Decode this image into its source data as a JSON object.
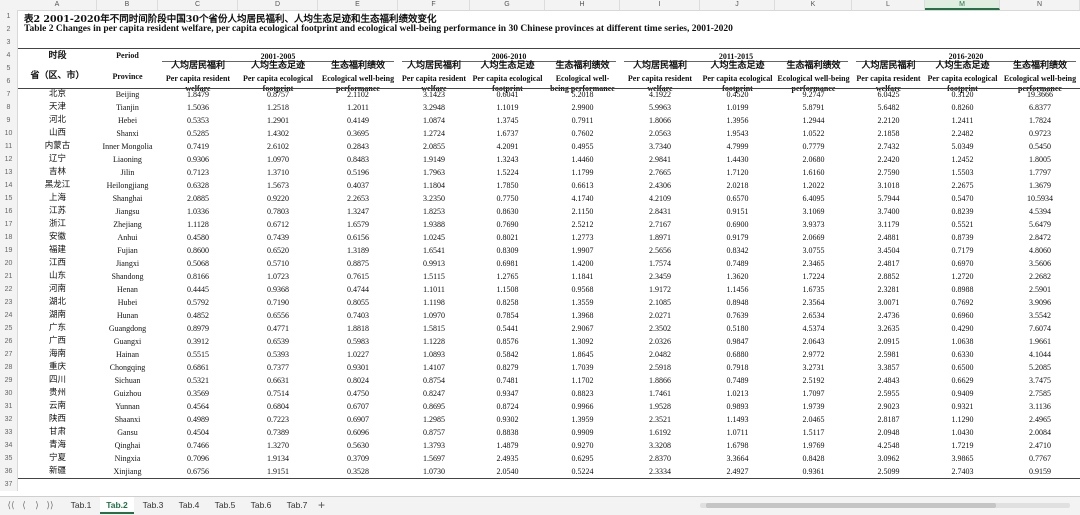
{
  "columns": [
    "A",
    "B",
    "C",
    "D",
    "E",
    "F",
    "G",
    "H",
    "I",
    "J",
    "K",
    "L",
    "M",
    "N"
  ],
  "selected_column": "M",
  "row_numbers": [
    1,
    2,
    3,
    4,
    5,
    6,
    7,
    8,
    9,
    10,
    11,
    12,
    13,
    14,
    15,
    16,
    17,
    18,
    19,
    20,
    21,
    22,
    23,
    24,
    25,
    26,
    27,
    28,
    29,
    30,
    31,
    32,
    33,
    34,
    35,
    36,
    37
  ],
  "title_cn": "表2 2001-2020年不同时间阶段中国30个省份人均居民福利、人均生态足迹和生态福利绩效变化",
  "title_en": "Table 2 Changes in per capita resident welfare, per capita ecological footprint and ecological well-being performance in 30 Chinese provinces at different time series, 2001-2020",
  "header": {
    "period_cn": "时段",
    "period_en": "Period",
    "province_cn": "省（区、市）",
    "province_en": "Province",
    "periods": [
      "2001-2005",
      "2006-2010",
      "2011-2015",
      "2016-2020"
    ],
    "metrics_cn": [
      "人均居民福利",
      "人均生态足迹",
      "生态福利绩效"
    ],
    "metrics_en": [
      "Per capita resident welfare",
      "Per capita ecological footprint",
      "Ecological well-being performance"
    ]
  },
  "rows": [
    {
      "cn": "北京",
      "en": "Beijing",
      "v": [
        "1.8479",
        "0.8757",
        "2.1102",
        "3.1423",
        "0.6041",
        "5.2018",
        "4.1922",
        "0.4520",
        "9.2747",
        "6.0425",
        "0.3120",
        "19.3666"
      ]
    },
    {
      "cn": "天津",
      "en": "Tianjin",
      "v": [
        "1.5036",
        "1.2518",
        "1.2011",
        "3.2948",
        "1.1019",
        "2.9900",
        "5.9963",
        "1.0199",
        "5.8791",
        "5.6482",
        "0.8260",
        "6.8377"
      ]
    },
    {
      "cn": "河北",
      "en": "Hebei",
      "v": [
        "0.5353",
        "1.2901",
        "0.4149",
        "1.0874",
        "1.3745",
        "0.7911",
        "1.8066",
        "1.3956",
        "1.2944",
        "2.2120",
        "1.2411",
        "1.7824"
      ]
    },
    {
      "cn": "山西",
      "en": "Shanxi",
      "v": [
        "0.5285",
        "1.4302",
        "0.3695",
        "1.2724",
        "1.6737",
        "0.7602",
        "2.0563",
        "1.9543",
        "1.0522",
        "2.1858",
        "2.2482",
        "0.9723"
      ]
    },
    {
      "cn": "内蒙古",
      "en": "Inner Mongolia",
      "v": [
        "0.7419",
        "2.6102",
        "0.2843",
        "2.0855",
        "4.2091",
        "0.4955",
        "3.7340",
        "4.7999",
        "0.7779",
        "2.7432",
        "5.0349",
        "0.5450"
      ]
    },
    {
      "cn": "辽宁",
      "en": "Liaoning",
      "v": [
        "0.9306",
        "1.0970",
        "0.8483",
        "1.9149",
        "1.3243",
        "1.4460",
        "2.9841",
        "1.4430",
        "2.0680",
        "2.2420",
        "1.2452",
        "1.8005"
      ]
    },
    {
      "cn": "吉林",
      "en": "Jilin",
      "v": [
        "0.7123",
        "1.3710",
        "0.5196",
        "1.7963",
        "1.5224",
        "1.1799",
        "2.7665",
        "1.7120",
        "1.6160",
        "2.7590",
        "1.5503",
        "1.7797"
      ]
    },
    {
      "cn": "黑龙江",
      "en": "Heilongjiang",
      "v": [
        "0.6328",
        "1.5673",
        "0.4037",
        "1.1804",
        "1.7850",
        "0.6613",
        "2.4306",
        "2.0218",
        "1.2022",
        "3.1018",
        "2.2675",
        "1.3679"
      ]
    },
    {
      "cn": "上海",
      "en": "Shanghai",
      "v": [
        "2.0885",
        "0.9220",
        "2.2653",
        "3.2350",
        "0.7750",
        "4.1740",
        "4.2109",
        "0.6570",
        "6.4095",
        "5.7944",
        "0.5470",
        "10.5934"
      ]
    },
    {
      "cn": "江苏",
      "en": "Jiangsu",
      "v": [
        "1.0336",
        "0.7803",
        "1.3247",
        "1.8253",
        "0.8630",
        "2.1150",
        "2.8431",
        "0.9151",
        "3.1069",
        "3.7400",
        "0.8239",
        "4.5394"
      ]
    },
    {
      "cn": "浙江",
      "en": "Zhejiang",
      "v": [
        "1.1128",
        "0.6712",
        "1.6579",
        "1.9388",
        "0.7690",
        "2.5212",
        "2.7167",
        "0.6900",
        "3.9373",
        "3.1179",
        "0.5521",
        "5.6479"
      ]
    },
    {
      "cn": "安徽",
      "en": "Anhui",
      "v": [
        "0.4580",
        "0.7439",
        "0.6156",
        "1.0245",
        "0.8021",
        "1.2773",
        "1.8971",
        "0.9179",
        "2.0669",
        "2.4881",
        "0.8739",
        "2.8472"
      ]
    },
    {
      "cn": "福建",
      "en": "Fujian",
      "v": [
        "0.8600",
        "0.6520",
        "1.3189",
        "1.6541",
        "0.8309",
        "1.9907",
        "2.5656",
        "0.8342",
        "3.0755",
        "3.4504",
        "0.7179",
        "4.8060"
      ]
    },
    {
      "cn": "江西",
      "en": "Jiangxi",
      "v": [
        "0.5068",
        "0.5710",
        "0.8875",
        "0.9913",
        "0.6981",
        "1.4200",
        "1.7574",
        "0.7489",
        "2.3465",
        "2.4817",
        "0.6970",
        "3.5606"
      ]
    },
    {
      "cn": "山东",
      "en": "Shandong",
      "v": [
        "0.8166",
        "1.0723",
        "0.7615",
        "1.5115",
        "1.2765",
        "1.1841",
        "2.3459",
        "1.3620",
        "1.7224",
        "2.8852",
        "1.2720",
        "2.2682"
      ]
    },
    {
      "cn": "河南",
      "en": "Henan",
      "v": [
        "0.4445",
        "0.9368",
        "0.4744",
        "1.1011",
        "1.1508",
        "0.9568",
        "1.9172",
        "1.1456",
        "1.6735",
        "2.3281",
        "0.8988",
        "2.5901"
      ]
    },
    {
      "cn": "湖北",
      "en": "Hubei",
      "v": [
        "0.5792",
        "0.7190",
        "0.8055",
        "1.1198",
        "0.8258",
        "1.3559",
        "2.1085",
        "0.8948",
        "2.3564",
        "3.0071",
        "0.7692",
        "3.9096"
      ]
    },
    {
      "cn": "湖南",
      "en": "Hunan",
      "v": [
        "0.4852",
        "0.6556",
        "0.7403",
        "1.0970",
        "0.7854",
        "1.3968",
        "2.0271",
        "0.7639",
        "2.6534",
        "2.4736",
        "0.6960",
        "3.5542"
      ]
    },
    {
      "cn": "广东",
      "en": "Guangdong",
      "v": [
        "0.8979",
        "0.4771",
        "1.8818",
        "1.5815",
        "0.5441",
        "2.9067",
        "2.3502",
        "0.5180",
        "4.5374",
        "3.2635",
        "0.4290",
        "7.6074"
      ]
    },
    {
      "cn": "广西",
      "en": "Guangxi",
      "v": [
        "0.3912",
        "0.6539",
        "0.5983",
        "1.1228",
        "0.8576",
        "1.3092",
        "2.0326",
        "0.9847",
        "2.0643",
        "2.0915",
        "1.0638",
        "1.9661"
      ]
    },
    {
      "cn": "海南",
      "en": "Hainan",
      "v": [
        "0.5515",
        "0.5393",
        "1.0227",
        "1.0893",
        "0.5842",
        "1.8645",
        "2.0482",
        "0.6880",
        "2.9772",
        "2.5981",
        "0.6330",
        "4.1044"
      ]
    },
    {
      "cn": "重庆",
      "en": "Chongqing",
      "v": [
        "0.6861",
        "0.7377",
        "0.9301",
        "1.4107",
        "0.8279",
        "1.7039",
        "2.5918",
        "0.7918",
        "3.2731",
        "3.3857",
        "0.6500",
        "5.2085"
      ]
    },
    {
      "cn": "四川",
      "en": "Sichuan",
      "v": [
        "0.5321",
        "0.6631",
        "0.8024",
        "0.8754",
        "0.7481",
        "1.1702",
        "1.8866",
        "0.7489",
        "2.5192",
        "2.4843",
        "0.6629",
        "3.7475"
      ]
    },
    {
      "cn": "贵州",
      "en": "Guizhou",
      "v": [
        "0.3569",
        "0.7514",
        "0.4750",
        "0.8247",
        "0.9347",
        "0.8823",
        "1.7461",
        "1.0213",
        "1.7097",
        "2.5955",
        "0.9409",
        "2.7585"
      ]
    },
    {
      "cn": "云南",
      "en": "Yunnan",
      "v": [
        "0.4564",
        "0.6804",
        "0.6707",
        "0.8695",
        "0.8724",
        "0.9966",
        "1.9528",
        "0.9893",
        "1.9739",
        "2.9023",
        "0.9321",
        "3.1136"
      ]
    },
    {
      "cn": "陕西",
      "en": "Shaanxi",
      "v": [
        "0.4989",
        "0.7223",
        "0.6907",
        "1.2985",
        "0.9302",
        "1.3959",
        "2.3521",
        "1.1493",
        "2.0465",
        "2.8187",
        "1.1290",
        "2.4965"
      ]
    },
    {
      "cn": "甘肃",
      "en": "Gansu",
      "v": [
        "0.4504",
        "0.7389",
        "0.6096",
        "0.8757",
        "0.8838",
        "0.9909",
        "1.6192",
        "1.0711",
        "1.5117",
        "2.0948",
        "1.0430",
        "2.0084"
      ]
    },
    {
      "cn": "青海",
      "en": "Qinghai",
      "v": [
        "0.7466",
        "1.3270",
        "0.5630",
        "1.3793",
        "1.4879",
        "0.9270",
        "3.3208",
        "1.6798",
        "1.9769",
        "4.2548",
        "1.7219",
        "2.4710"
      ]
    },
    {
      "cn": "宁夏",
      "en": "Ningxia",
      "v": [
        "0.7096",
        "1.9134",
        "0.3709",
        "1.5697",
        "2.4935",
        "0.6295",
        "2.8370",
        "3.3664",
        "0.8428",
        "3.0962",
        "3.9865",
        "0.7767"
      ]
    },
    {
      "cn": "新疆",
      "en": "Xinjiang",
      "v": [
        "0.6756",
        "1.9151",
        "0.3528",
        "1.0730",
        "2.0540",
        "0.5224",
        "2.3334",
        "2.4927",
        "0.9361",
        "2.5099",
        "2.7403",
        "0.9159"
      ]
    }
  ],
  "tabs": {
    "nav": [
      "⟨⟨",
      "⟨",
      "⟩",
      "⟩⟩"
    ],
    "items": [
      "Tab.1",
      "Tab.2",
      "Tab.3",
      "Tab.4",
      "Tab.5",
      "Tab.6",
      "Tab.7"
    ],
    "active": "Tab.2",
    "add": "+"
  }
}
